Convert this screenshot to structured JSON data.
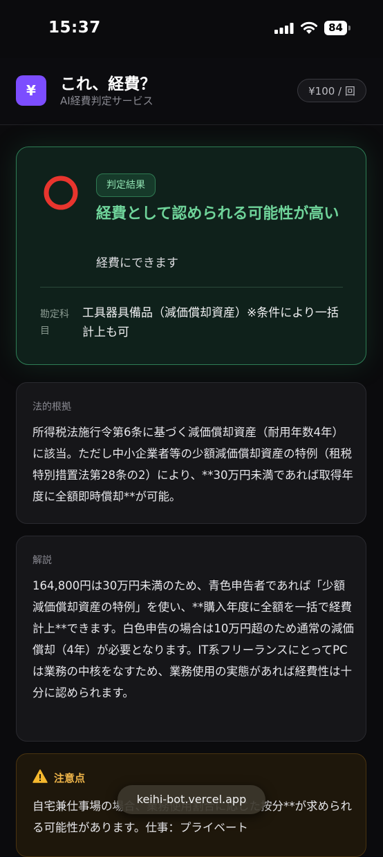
{
  "status_bar": {
    "time": "15:37",
    "battery": "84"
  },
  "header": {
    "logo_text": "¥",
    "title": "これ、経費？",
    "subtitle": "AI経費判定サービス",
    "price": "¥100 / 回"
  },
  "result": {
    "badge": "判定結果",
    "verdict": "経費として認められる可能性が高い",
    "verdict_sub": "経費にできます",
    "account_label": "勘定科目",
    "account_value": "工具器具備品（減価償却資産）※条件により一括計上も可",
    "accent": "#6fd49a"
  },
  "legal": {
    "label": "法的根拠",
    "body": "所得税法施行令第6条に基づく減価償却資産（耐用年数4年）に該当。ただし中小企業者等の少額減価償却資産の特例（租税特別措置法第28条の2）により、**30万円未満であれば取得年度に全額即時償却**が可能。"
  },
  "explanation": {
    "label": "解説",
    "body": "164,800円は30万円未満のため、青色申告者であれば「少額減価償却資産の特例」を使い、**購入年度に全額を一括で経費計上**できます。白色申告の場合は10万円超のため通常の減価償却（4年）が必要となります。IT系フリーランスにとってPCは業務の中核をなすため、業務使用の実態があれば経費性は十分に認められます。"
  },
  "caution": {
    "label": "注意点",
    "body": "自宅兼仕事場の場合、業務使用割合に応じた按分**が求められる可能性があります。仕事：プライベート"
  },
  "browser": {
    "url": "keihi-bot.vercel.app"
  }
}
